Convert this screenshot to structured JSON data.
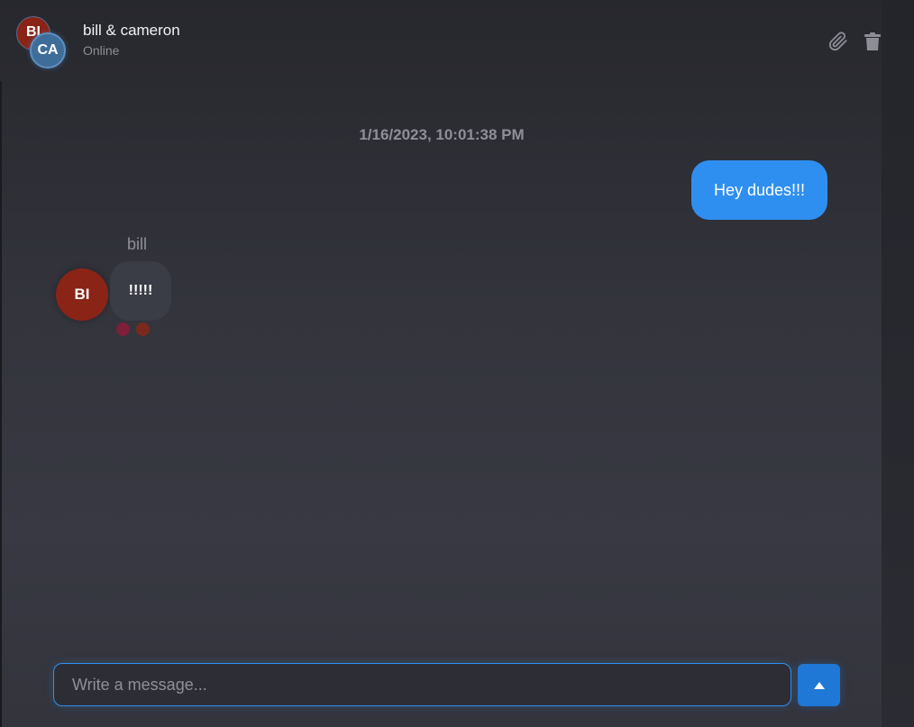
{
  "header": {
    "title": "bill & cameron",
    "status": "Online",
    "avatars": [
      {
        "initials": "BI",
        "color": "#8a2417"
      },
      {
        "initials": "CA",
        "color": "#3f6d9a"
      }
    ],
    "actions": [
      {
        "icon": "paperclip-icon"
      },
      {
        "icon": "trash-icon"
      }
    ]
  },
  "conversation": {
    "timestamp": "1/16/2023, 10:01:38 PM",
    "messages": [
      {
        "direction": "outgoing",
        "text": "Hey dudes!!!",
        "color": "#2f8ff0"
      },
      {
        "direction": "incoming",
        "sender": "bill",
        "sender_initials": "BI",
        "text": "!!!!!",
        "color": "#3a3c46"
      }
    ],
    "reaction_dot_colors": [
      "#7d1e3a",
      "#7a2a1c"
    ]
  },
  "composer": {
    "placeholder": "Write a message...",
    "value": "",
    "send_icon": "triangle-up-icon"
  }
}
